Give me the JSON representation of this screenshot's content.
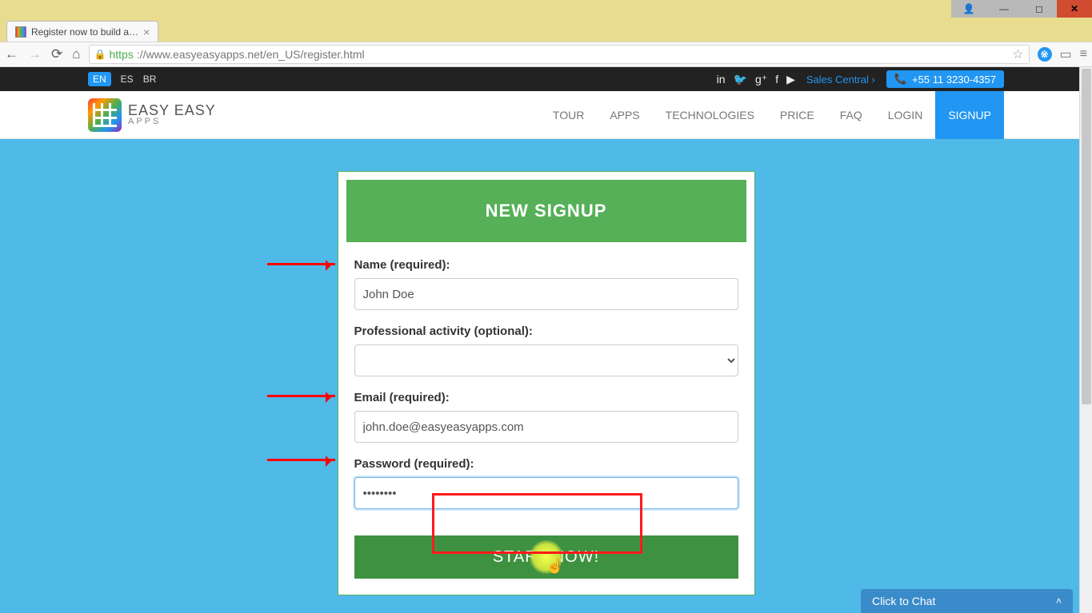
{
  "browser": {
    "tab_title": "Register now to build a…",
    "url_scheme": "https",
    "url_host": "://www.easyeasyapps.net",
    "url_path": "/en_US/register.html"
  },
  "topbar": {
    "lang_active": "EN",
    "langs": [
      "ES",
      "BR"
    ],
    "sales_link": "Sales Central",
    "phone": "+55 11 3230-4357"
  },
  "logo": {
    "line1": "EASY EASY",
    "line2": "APPS"
  },
  "nav": {
    "items": [
      "TOUR",
      "APPS",
      "TECHNOLOGIES",
      "PRICE",
      "FAQ",
      "LOGIN",
      "SIGNUP"
    ],
    "active_index": 6
  },
  "form": {
    "heading": "NEW SIGNUP",
    "name_label": "Name (required):",
    "name_value": "John Doe",
    "activity_label": "Professional activity (optional):",
    "activity_value": "",
    "email_label": "Email (required):",
    "email_value": "john.doe@easyeasyapps.com",
    "password_label": "Password (required):",
    "password_value": "••••••••",
    "submit_label": "START NOW!"
  },
  "chat": {
    "label": "Click to Chat"
  }
}
